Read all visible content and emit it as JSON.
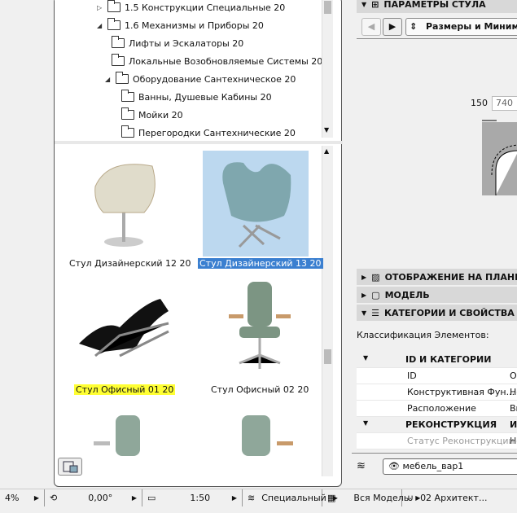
{
  "tree": {
    "items": [
      {
        "label": "1.5 Конструкции Специальные 20",
        "expanded": false
      },
      {
        "label": "1.6 Механизмы и Приборы 20",
        "expanded": true
      },
      {
        "label": "Лифты и Эскалаторы 20"
      },
      {
        "label": "Локальные Возобновляемые Системы 20"
      },
      {
        "label": "Оборудование Сантехническое 20",
        "expanded": true
      },
      {
        "label": "Ванны, Душевые Кабины 20"
      },
      {
        "label": "Мойки 20"
      },
      {
        "label": "Перегородки Сантехнические 20"
      }
    ]
  },
  "gallery": {
    "items": [
      {
        "label": "Стул Дизайнерский 12 20",
        "state": "normal"
      },
      {
        "label": "Стул Дизайнерский 13 20",
        "state": "selected"
      },
      {
        "label": "Стул Офисный 01 20",
        "state": "highlighted"
      },
      {
        "label": "Стул Офисный 02 20",
        "state": "normal"
      }
    ]
  },
  "right": {
    "header": "ПАРАМЕТРЫ СТУЛА",
    "page_select": "Размеры и Минимал",
    "dim_label": "150",
    "dim_value": "740",
    "sections": [
      "ОТОБРАЖЕНИЕ НА ПЛАНЕ И",
      "МОДЕЛЬ",
      "КАТЕГОРИИ И СВОЙСТВА"
    ],
    "classification_label": "Классификация Элементов:",
    "groups": [
      {
        "name": "ID И КАТЕГОРИИ",
        "value": "",
        "rows": [
          [
            "ID",
            "ОБ"
          ],
          [
            "Конструктивная Фун...",
            "Не"
          ],
          [
            "Расположение",
            "Вн"
          ]
        ]
      },
      {
        "name": "РЕКОНСТРУКЦИЯ",
        "value": "Ис",
        "rows": [
          [
            "Статус Реконструкции",
            "Но"
          ]
        ]
      }
    ],
    "layer": "мебель_вар1"
  },
  "status": {
    "zoom": "4%",
    "angle": "0,00°",
    "scale": "1:50",
    "layer_combo": "Специальный",
    "model_view": "Вся Модель",
    "pen_set": "02 Архитект..."
  },
  "colors": {
    "selection": "#3a7fd0",
    "highlight": "#ffff33",
    "thumb_selected_bg": "#bcd8ef"
  }
}
